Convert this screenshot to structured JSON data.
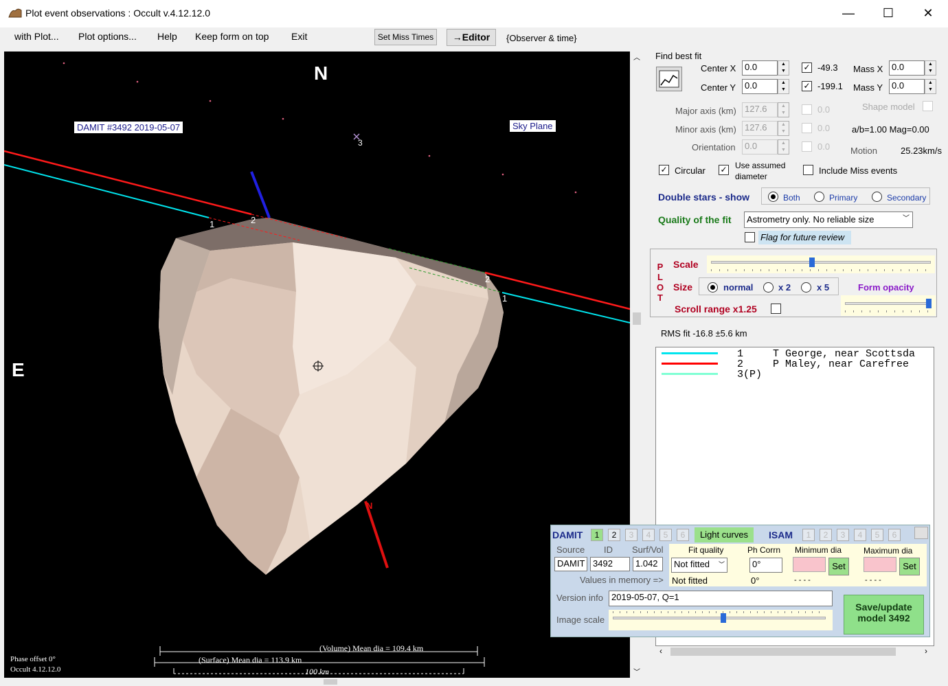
{
  "window": {
    "title": "Plot event observations : Occult v.4.12.12.0",
    "minimize": "—",
    "maximize": "☐",
    "close": "✕"
  },
  "menu": {
    "with_plot": "with Plot...",
    "plot_options": "Plot options...",
    "help": "Help",
    "keep_on_top": "Keep form on top",
    "exit": "Exit",
    "set_miss_times": "Set Miss Times",
    "editor": "→Editor",
    "observer_time": "{Observer & time}"
  },
  "plot": {
    "north": "N",
    "east": "E",
    "model_label": "DAMIT #3492 2019-05-07",
    "sky_plane": "Sky Plane",
    "star_label": "3",
    "chord_labels": [
      "1",
      "2",
      "2",
      "1"
    ],
    "pole_label": "N",
    "phase_offset": "Phase offset 0°",
    "version": "Occult 4.12.12.0",
    "volume_dia": "(Volume) Mean dia = 109.4 km",
    "surface_dia": "(Surface) Mean dia = 113.9 km",
    "scale_bar": "100 km"
  },
  "fit": {
    "title": "Find best fit",
    "center_x_label": "Center X",
    "center_x": "0.0",
    "center_y_label": "Center Y",
    "center_y": "0.0",
    "cb_x_value": "-49.3",
    "cb_y_value": "-199.1",
    "mass_x_label": "Mass X",
    "mass_x": "0.0",
    "mass_y_label": "Mass Y",
    "mass_y": "0.0",
    "major_axis_label": "Major axis (km)",
    "major_axis": "127.6",
    "major_cb_value": "0.0",
    "minor_axis_label": "Minor axis (km)",
    "minor_axis": "127.6",
    "minor_cb_value": "0.0",
    "orientation_label": "Orientation",
    "orientation": "0.0",
    "orientation_cb_value": "0.0",
    "shape_model": "Shape model",
    "ratio": "a/b=1.00  Mag=0.00",
    "motion_label": "Motion",
    "motion": "25.23km/s",
    "circular": "Circular",
    "use_assumed": "Use assumed",
    "diameter": "diameter",
    "include_miss": "Include Miss events"
  },
  "double_stars": {
    "label": "Double stars - show",
    "both": "Both",
    "primary": "Primary",
    "secondary": "Secondary"
  },
  "quality": {
    "label": "Quality of the fit",
    "value": "Astrometry only. No reliable size",
    "flag": "Flag for future review"
  },
  "plot_opts": {
    "letters": [
      "P",
      "L",
      "O",
      "T"
    ],
    "scale": "Scale",
    "size": "Size",
    "normal": "normal",
    "x2": "x 2",
    "x5": "x 5",
    "form_opacity": "Form opacity",
    "scroll_range": "Scroll range x1.25",
    "scale_level": 0.46,
    "opacity_level": 0.97
  },
  "rms": "RMS fit -16.8 ±5.6 km",
  "observers": [
    {
      "num": "1",
      "name": "T George, near Scottsda",
      "color": "#00e5ee"
    },
    {
      "num": "2",
      "name": "P Maley, near Carefree",
      "color": "#ff0000"
    },
    {
      "num": "3(P)",
      "name": "",
      "color": "#7fffd4"
    }
  ],
  "damit": {
    "label": "DAMIT",
    "nums": [
      "1",
      "2",
      "3",
      "4",
      "5",
      "6"
    ],
    "light_curves": "Light curves",
    "isam": "ISAM",
    "isam_nums": [
      "1",
      "2",
      "3",
      "4",
      "5",
      "6"
    ],
    "source_h": "Source",
    "id_h": "ID",
    "surf_h": "Surf/Vol",
    "fitq_h": "Fit quality",
    "phcorr_h": "Ph Corrn",
    "min_h": "Minimum dia",
    "max_h": "Maximum dia",
    "source": "DAMIT",
    "id": "3492",
    "surf": "1.042",
    "fitq": "Not fitted",
    "phcorr": "0°",
    "set": "Set",
    "mem_label": "Values in memory =>",
    "mem_fit": "Not fitted",
    "mem_ph": "0°",
    "mem_min": "- - - -",
    "mem_max": "- - - -",
    "version_label": "Version info",
    "version": "2019-05-07, Q=1",
    "image_scale": "Image scale",
    "image_scale_level": 0.52,
    "save": "Save/update model 3492"
  }
}
